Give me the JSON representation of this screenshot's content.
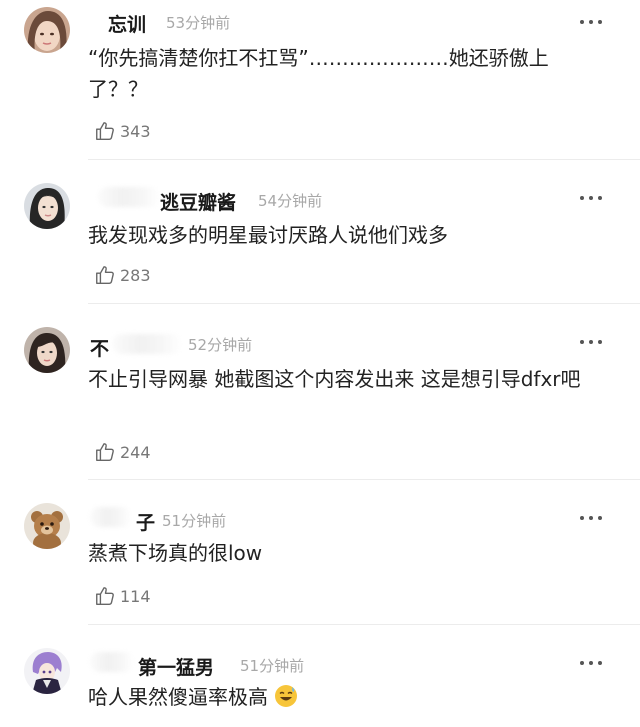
{
  "comments": [
    {
      "name": "忘训",
      "time": "53分钟前",
      "text": "“你先搞清楚你扛不扛骂”…………………她还骄傲上了？？",
      "likes": "343",
      "avatar": "avatar-woman-long-hair"
    },
    {
      "name": "逃豆瓣酱",
      "time": "54分钟前",
      "text": "我发现戏多的明星最讨厌路人说他们戏多",
      "likes": "283",
      "avatar": "avatar-woman-short-hair"
    },
    {
      "name": "不",
      "time": "52分钟前",
      "text": "不止引导网暴 她截图这个内容发出来 这是想引导dfxr吧",
      "likes": "244",
      "avatar": "avatar-woman-dark-hair"
    },
    {
      "name": "子",
      "time": "51分钟前",
      "text": "蒸煮下场真的很low",
      "likes": "114",
      "avatar": "avatar-teddy-bear"
    },
    {
      "name": "第一猛男",
      "time": "51分钟前",
      "text": "哈人果然傻逼率极高",
      "likes": "",
      "avatar": "avatar-anime-character"
    }
  ],
  "icons": {
    "more": "more-dots-icon",
    "like": "thumbs-up-icon",
    "emoji": "sweat-smile-emoji"
  },
  "colors": {
    "name": "#1a1a1a",
    "time": "#a8a8a8",
    "text": "#222222",
    "likes": "#777777"
  }
}
